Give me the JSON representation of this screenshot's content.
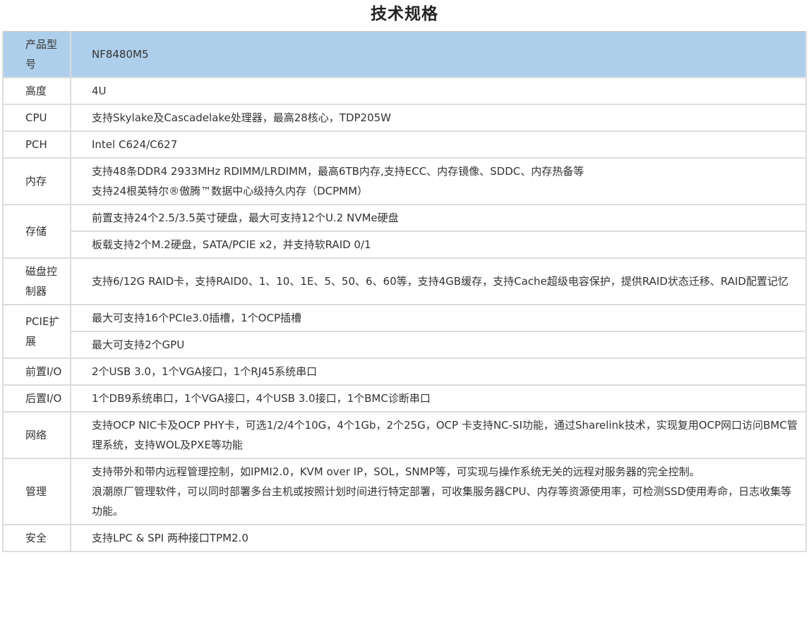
{
  "title": "技术规格",
  "rows": [
    {
      "label": "产品型号",
      "values": [
        [
          "NF8480M5"
        ]
      ]
    },
    {
      "label": "高度",
      "values": [
        [
          "4U"
        ]
      ]
    },
    {
      "label": "CPU",
      "values": [
        [
          "支持Skylake及Cascadelake处理器，最高28核心，TDP205W"
        ]
      ]
    },
    {
      "label": "PCH",
      "values": [
        [
          "Intel C624/C627"
        ]
      ]
    },
    {
      "label": "内存",
      "values": [
        [
          "支持48条DDR4 2933MHz  RDIMM/LRDIMM，最高6TB内存,支持ECC、内存镜像、SDDC、内存热备等",
          "支持24根英特尔®傲腾™数据中心级持久内存（DCPMM）"
        ]
      ]
    },
    {
      "label": "存储",
      "values": [
        [
          "前置支持24个2.5/3.5英寸硬盘，最大可支持12个U.2 NVMe硬盘"
        ],
        [
          "板载支持2个M.2硬盘，SATA/PCIE x2，并支持软RAID 0/1"
        ]
      ]
    },
    {
      "label": "磁盘控制器",
      "values": [
        [
          "支持6/12G RAID卡，支持RAID0、1、10、1E、5、50、6、60等，支持4GB缓存，支持Cache超级电容保护，提供RAID状态迁移、RAID配置记忆"
        ]
      ]
    },
    {
      "label": "PCIE扩展",
      "values": [
        [
          "最大可支持16个PCIe3.0插槽，1个OCP插槽"
        ],
        [
          "最大可支持2个GPU"
        ]
      ]
    },
    {
      "label": "前置I/O",
      "values": [
        [
          "2个USB 3.0，1个VGA接口，1个RJ45系统串口"
        ]
      ]
    },
    {
      "label": "后置I/O",
      "values": [
        [
          "1个DB9系统串口，1个VGA接口，4个USB 3.0接口，1个BMC诊断串口"
        ]
      ]
    },
    {
      "label": "网络",
      "values": [
        [
          "支持OCP NIC卡及OCP PHY卡，可选1/2/4个10G，4个1Gb，2个25G，OCP 卡支持NC-SI功能，通过Sharelink技术，实现复用OCP网口访问BMC管理系统，支持WOL及PXE等功能"
        ]
      ]
    },
    {
      "label": "管理",
      "values": [
        [
          "支持带外和带内远程管理控制，如IPMI2.0，KVM over IP，SOL，SNMP等，可实现与操作系统无关的远程对服务器的完全控制。",
          "浪潮原厂管理软件，可以同时部署多台主机或按照计划时间进行特定部署，可收集服务器CPU、内存等资源使用率，可检测SSD使用寿命，日志收集等功能。"
        ]
      ]
    },
    {
      "label": "安全",
      "values": [
        [
          "支持LPC & SPI 两种接口TPM2.0"
        ]
      ]
    }
  ]
}
